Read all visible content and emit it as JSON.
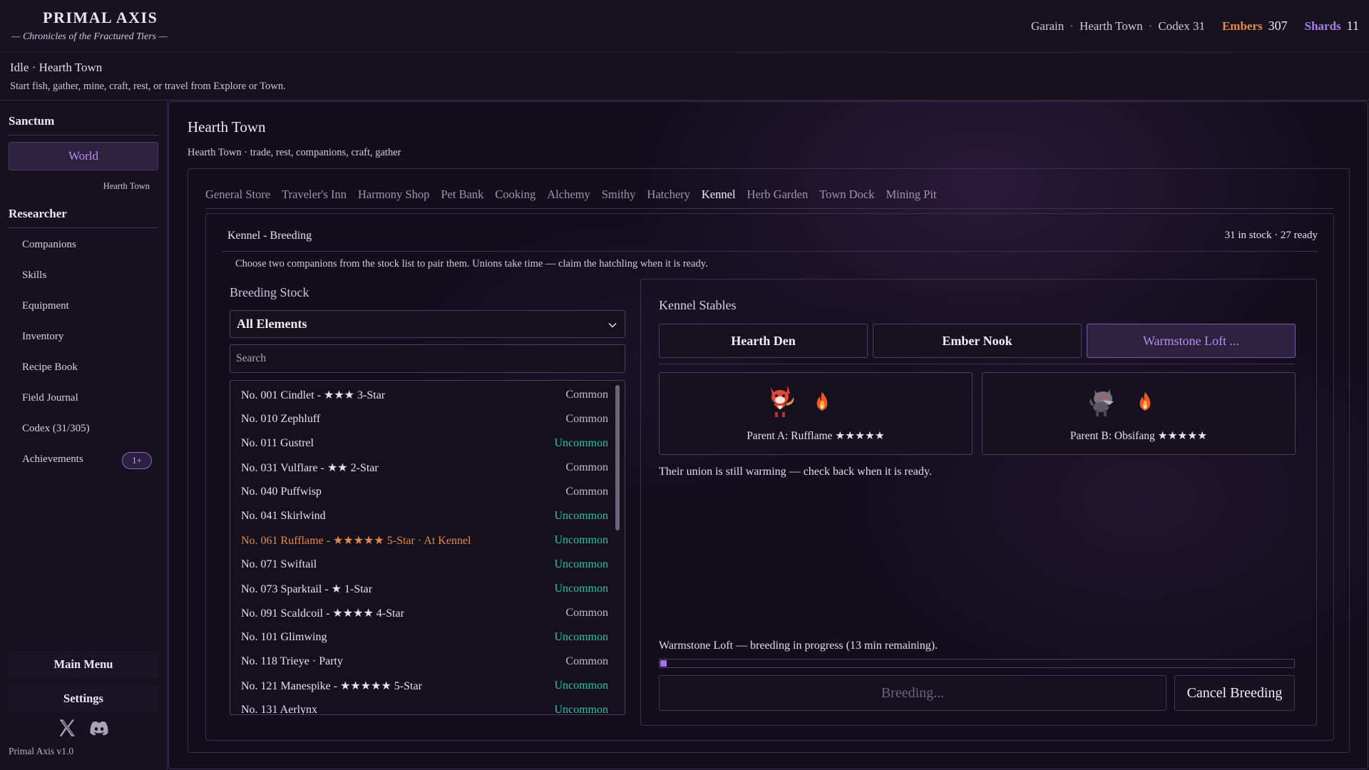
{
  "header": {
    "title": "PRIMAL AXIS",
    "subtitle": "— Chronicles of the Fractured Tiers —",
    "player": "Garain",
    "location": "Hearth Town",
    "codex": "Codex 31",
    "embers_label": "Embers",
    "embers_value": "307",
    "shards_label": "Shards",
    "shards_value": "11",
    "separator": "·"
  },
  "status": {
    "state": "Idle",
    "location": "Hearth Town",
    "hint": "Start fish, gather, mine, craft, rest, or travel from Explore or Town."
  },
  "sidebar": {
    "sanctum_heading": "Sanctum",
    "world_button": "World",
    "world_sub": "Hearth Town",
    "researcher_heading": "Researcher",
    "items": [
      {
        "label": "Companions"
      },
      {
        "label": "Skills"
      },
      {
        "label": "Equipment"
      },
      {
        "label": "Inventory"
      },
      {
        "label": "Recipe Book"
      },
      {
        "label": "Field Journal"
      },
      {
        "label": "Codex (31/305)"
      },
      {
        "label": "Achievements"
      }
    ],
    "achievements_badge": "1+",
    "main_menu": "Main Menu",
    "settings": "Settings",
    "version": "Primal Axis  v1.0"
  },
  "main": {
    "title": "Hearth Town",
    "subtitle": "Hearth Town · trade, rest, companions, craft, gather",
    "tabs": [
      {
        "label": "General Store",
        "active": false
      },
      {
        "label": "Traveler's Inn",
        "active": false
      },
      {
        "label": "Harmony Shop",
        "active": false
      },
      {
        "label": "Pet Bank",
        "active": false
      },
      {
        "label": "Cooking",
        "active": false
      },
      {
        "label": "Alchemy",
        "active": false
      },
      {
        "label": "Smithy",
        "active": false
      },
      {
        "label": "Hatchery",
        "active": false
      },
      {
        "label": "Kennel",
        "active": true
      },
      {
        "label": "Herb Garden",
        "active": false
      },
      {
        "label": "Town Dock",
        "active": false
      },
      {
        "label": "Mining Pit",
        "active": false
      }
    ]
  },
  "kennel": {
    "title": "Kennel - Breeding",
    "stock_summary": "31 in stock · 27 ready",
    "description": "Choose two companions from the stock list to pair them. Unions take time — claim the hatchling when it is ready.",
    "breeding_stock_title": "Breeding Stock",
    "element_filter": "All Elements",
    "search_placeholder": "Search",
    "stock": [
      {
        "name": "No. 001 Cindlet - ★★★ 3-Star",
        "rarity": "Common",
        "highlight": false
      },
      {
        "name": "No. 010 Zephluff",
        "rarity": "Common",
        "highlight": false
      },
      {
        "name": "No. 011 Gustrel",
        "rarity": "Uncommon",
        "highlight": false
      },
      {
        "name": "No. 031 Vulflare - ★★ 2-Star",
        "rarity": "Common",
        "highlight": false
      },
      {
        "name": "No. 040 Puffwisp",
        "rarity": "Common",
        "highlight": false
      },
      {
        "name": "No. 041 Skirlwind",
        "rarity": "Uncommon",
        "highlight": false
      },
      {
        "name": "No. 061 Rufflame - ★★★★★ 5-Star · At Kennel",
        "rarity": "Uncommon",
        "highlight": true
      },
      {
        "name": "No. 071 Swiftail",
        "rarity": "Uncommon",
        "highlight": false
      },
      {
        "name": "No. 073 Sparktail - ★ 1-Star",
        "rarity": "Uncommon",
        "highlight": false
      },
      {
        "name": "No. 091 Scaldcoil - ★★★★ 4-Star",
        "rarity": "Common",
        "highlight": false
      },
      {
        "name": "No. 101 Glimwing",
        "rarity": "Uncommon",
        "highlight": false
      },
      {
        "name": "No. 118 Trieye · Party",
        "rarity": "Common",
        "highlight": false
      },
      {
        "name": "No. 121 Manespike - ★★★★★ 5-Star",
        "rarity": "Uncommon",
        "highlight": false
      },
      {
        "name": "No. 131 Aerlynx",
        "rarity": "Uncommon",
        "highlight": false
      }
    ]
  },
  "stables": {
    "title": "Kennel Stables",
    "tabs": [
      {
        "label": "Hearth Den",
        "active": false
      },
      {
        "label": "Ember Nook",
        "active": false
      },
      {
        "label": "Warmstone Loft ...",
        "active": true
      }
    ],
    "parent_a": "Parent A: Rufflame ★★★★★",
    "parent_b": "Parent B: Obsifang ★★★★★",
    "message": "Their union is still warming — check back when it is ready.",
    "progress_text": "Warmstone Loft — breeding in progress (13 min remaining).",
    "progress": 0.01,
    "breeding_button": "Breeding...",
    "cancel_button": "Cancel Breeding"
  },
  "colors": {
    "accent_purple": "#b98ef0",
    "ember_orange": "#e48a4c",
    "uncommon_teal": "#37c0a4",
    "common_gray": "#c2bacd"
  },
  "icons": {
    "pet_a": "fire-fox-sprite",
    "pet_b": "gray-wolf-sprite",
    "element": "fire-element-icon",
    "social_x": "x-logo-icon",
    "social_discord": "discord-logo-icon",
    "select_chevron": "chevron-down-icon"
  }
}
